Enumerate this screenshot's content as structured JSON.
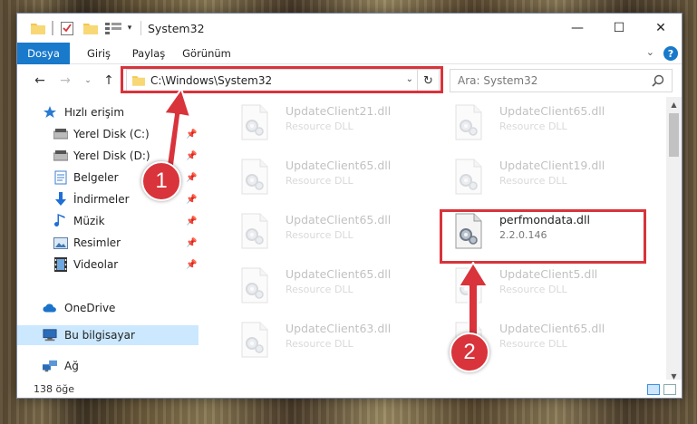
{
  "window": {
    "title": "System32",
    "controls": {
      "minimize": "—",
      "maximize": "☐",
      "close": "✕"
    }
  },
  "ribbon": {
    "tabs": [
      "Dosya",
      "Giriş",
      "Paylaş",
      "Görünüm"
    ],
    "help": "?",
    "expand": "⌄"
  },
  "nav": {
    "back": "←",
    "forward": "→",
    "recent": "⌄",
    "up": "↑",
    "address": "C:\\Windows\\System32",
    "address_dropdown": "⌄",
    "refresh": "↻",
    "search_placeholder": "Ara: System32"
  },
  "sidebar": {
    "items": [
      {
        "label": "Hızlı erişim",
        "icon": "star-icon",
        "pinned": false
      },
      {
        "label": "Yerel Disk (C:)",
        "icon": "drive-icon",
        "pinned": true
      },
      {
        "label": "Yerel Disk (D:)",
        "icon": "drive-icon",
        "pinned": true
      },
      {
        "label": "Belgeler",
        "icon": "documents-icon",
        "pinned": true
      },
      {
        "label": "İndirmeler",
        "icon": "download-icon",
        "pinned": true
      },
      {
        "label": "Müzik",
        "icon": "music-icon",
        "pinned": true
      },
      {
        "label": "Resimler",
        "icon": "pictures-icon",
        "pinned": true
      },
      {
        "label": "Videolar",
        "icon": "video-icon",
        "pinned": true
      },
      {
        "label": "OneDrive",
        "icon": "cloud-icon",
        "pinned": false
      },
      {
        "label": "Bu bilgisayar",
        "icon": "computer-icon",
        "pinned": false,
        "selected": true
      },
      {
        "label": "Ağ",
        "icon": "network-icon",
        "pinned": false
      }
    ],
    "pin_glyph": "📌"
  },
  "files": [
    {
      "name": "UpdateClient21.dll",
      "sub": "Resource DLL",
      "faded": true
    },
    {
      "name": "UpdateClient65.dll",
      "sub": "Resource DLL",
      "faded": true
    },
    {
      "name": "UpdateClient65.dll",
      "sub": "Resource DLL",
      "faded": true
    },
    {
      "name": "UpdateClient19.dll",
      "sub": "Resource DLL",
      "faded": true
    },
    {
      "name": "UpdateClient65.dll",
      "sub": "Resource DLL",
      "faded": true
    },
    {
      "name": "perfmondata.dll",
      "sub": "2.2.0.146",
      "faded": false
    },
    {
      "name": "UpdateClient65.dll",
      "sub": "Resource DLL",
      "faded": true
    },
    {
      "name": "UpdateClient5.dll",
      "sub": "Resource DLL",
      "faded": true
    },
    {
      "name": "UpdateClient63.dll",
      "sub": "Resource DLL",
      "faded": true
    },
    {
      "name": "UpdateClient65.dll",
      "sub": "Resource DLL",
      "faded": true
    }
  ],
  "status": {
    "count": "138 öğe"
  },
  "annotations": {
    "badge1": "1",
    "badge2": "2"
  },
  "colors": {
    "accent": "#1979ca",
    "highlight": "#d9333b",
    "selected": "#cce8ff"
  }
}
